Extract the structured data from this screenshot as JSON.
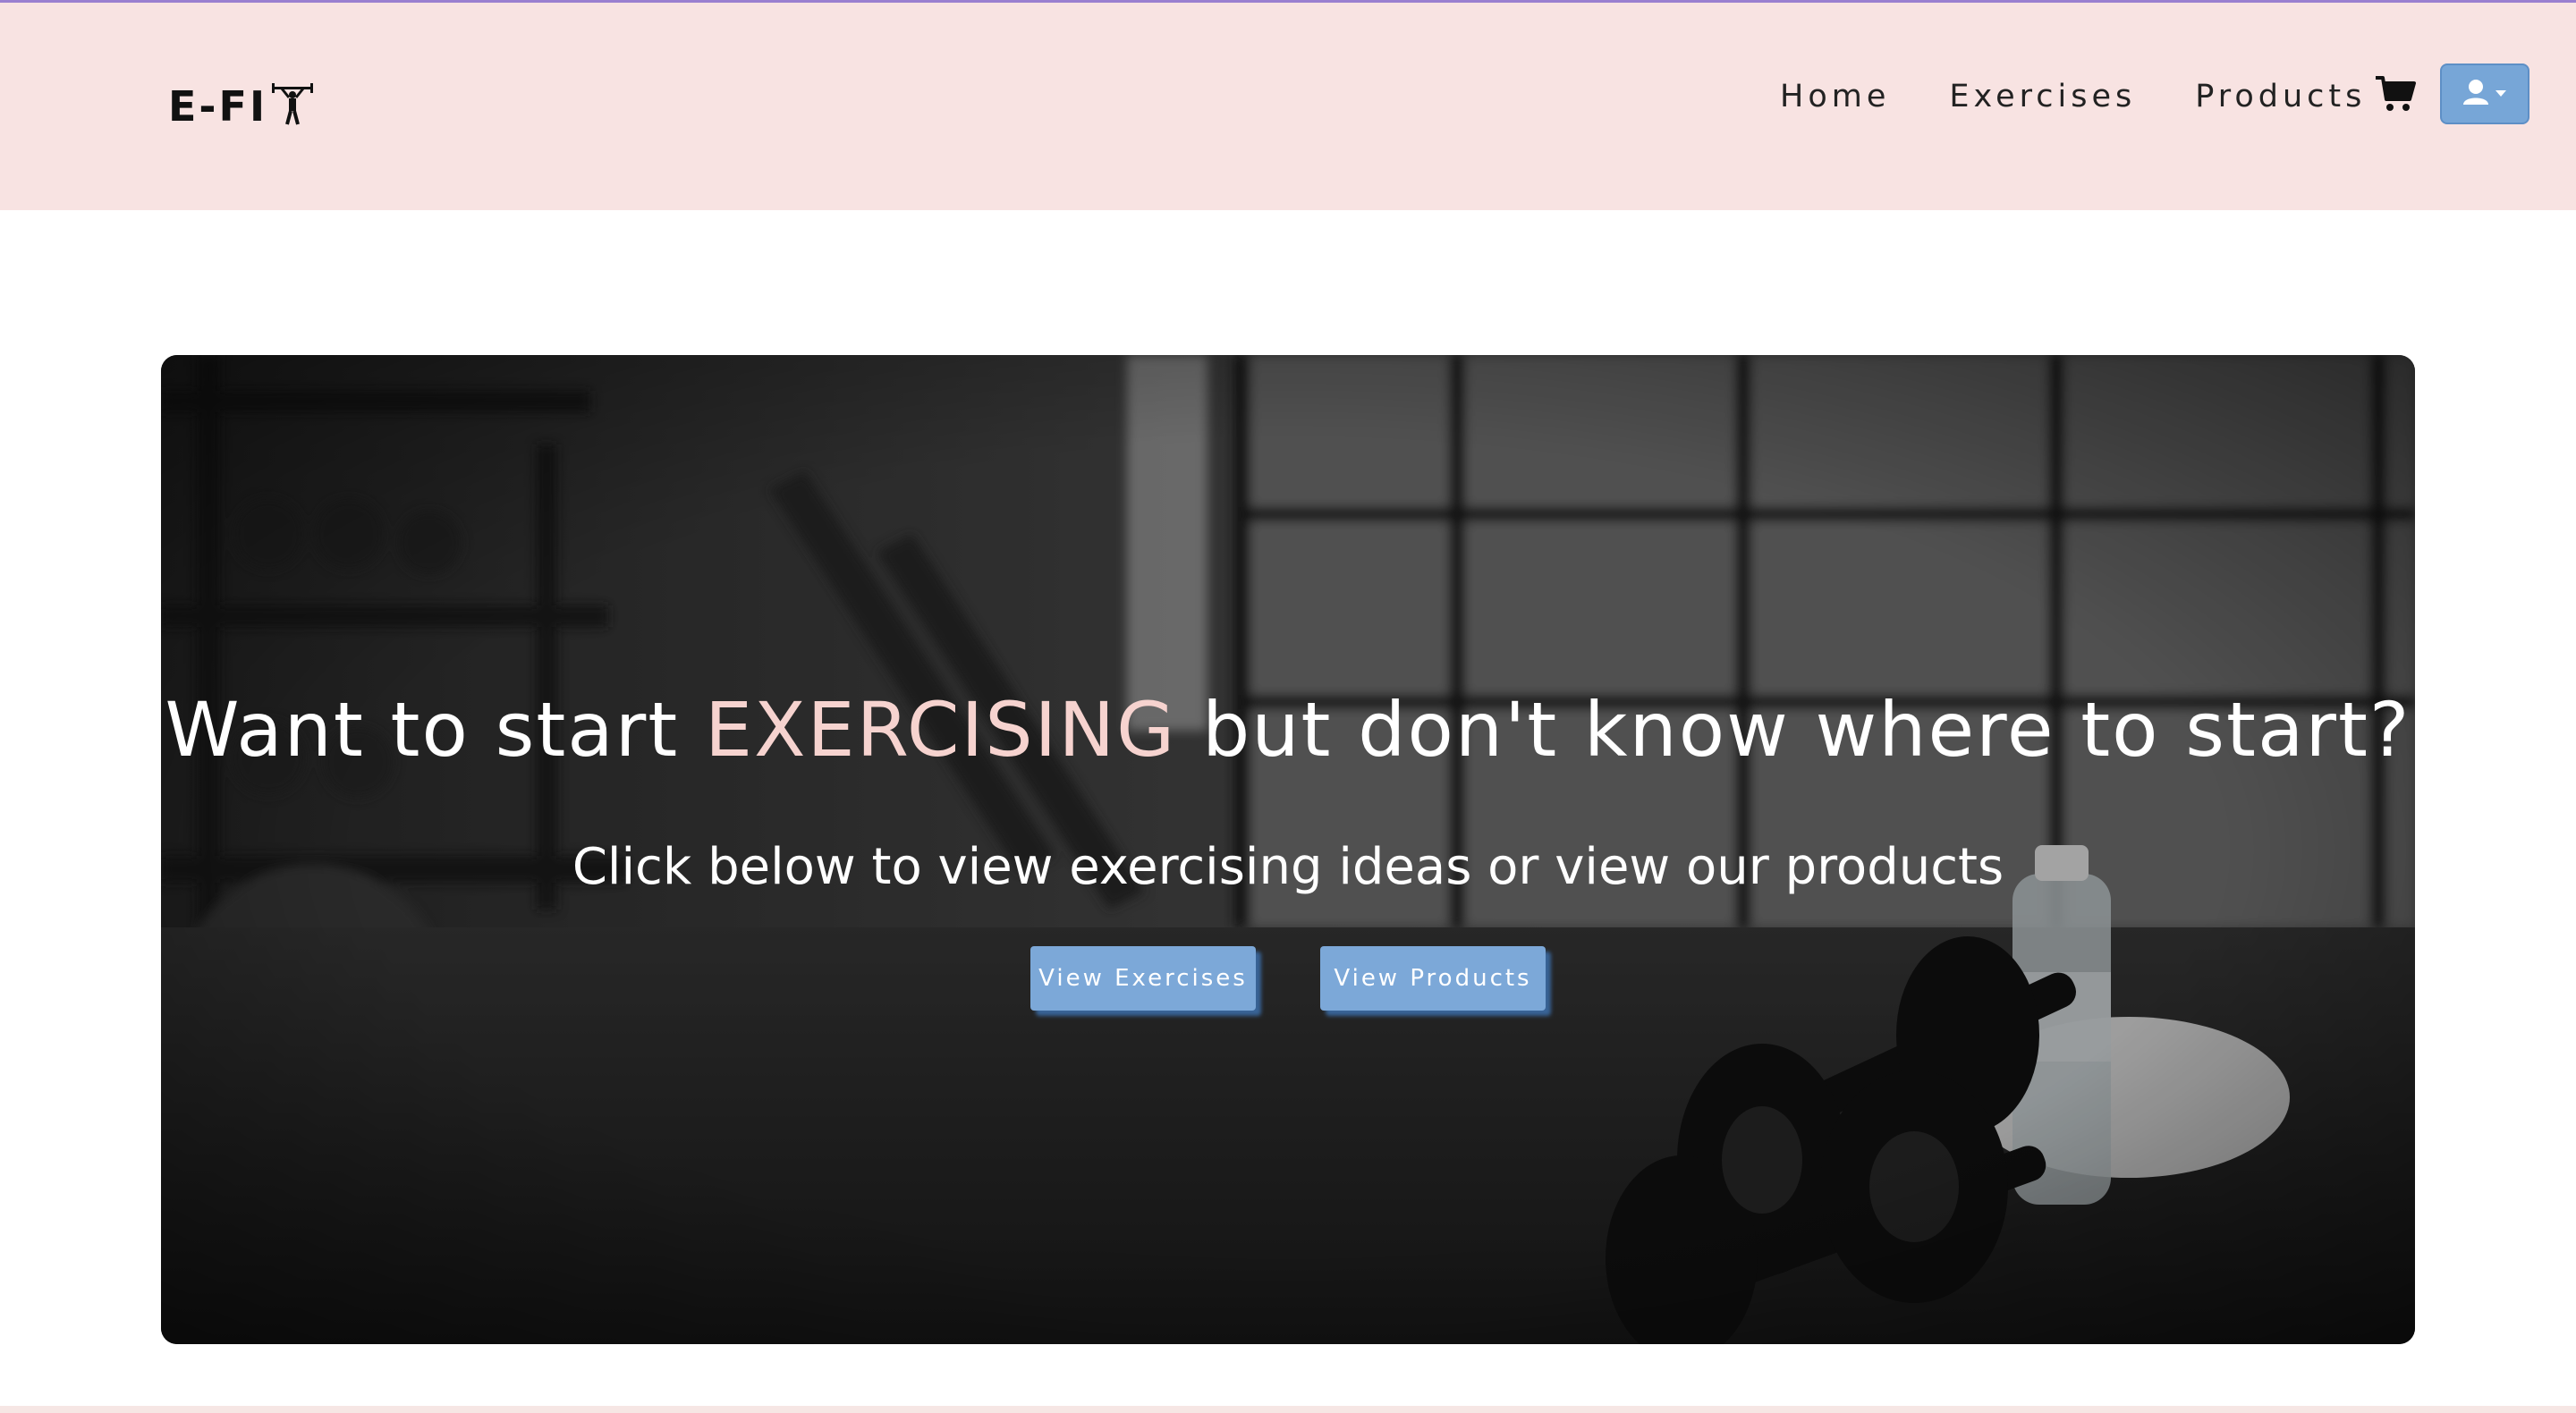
{
  "navbar": {
    "brand_text": "E-FI",
    "brand_icon": "weightlifter-icon",
    "links": [
      "Home",
      "Exercises",
      "Products"
    ],
    "cart_icon": "cart-icon",
    "user_icon": "user-icon",
    "background": "#f8e3e2"
  },
  "hero": {
    "title_before": "Want to start ",
    "title_accent": "EXERCISING",
    "title_after": " but don't know where to start?",
    "subtitle": "Click below to view exercising ideas or view our products",
    "buttons": {
      "exercises": "View Exercises",
      "products": "View Products"
    },
    "accent_color": "#f6d3cf",
    "button_color": "#7ca8d8"
  }
}
